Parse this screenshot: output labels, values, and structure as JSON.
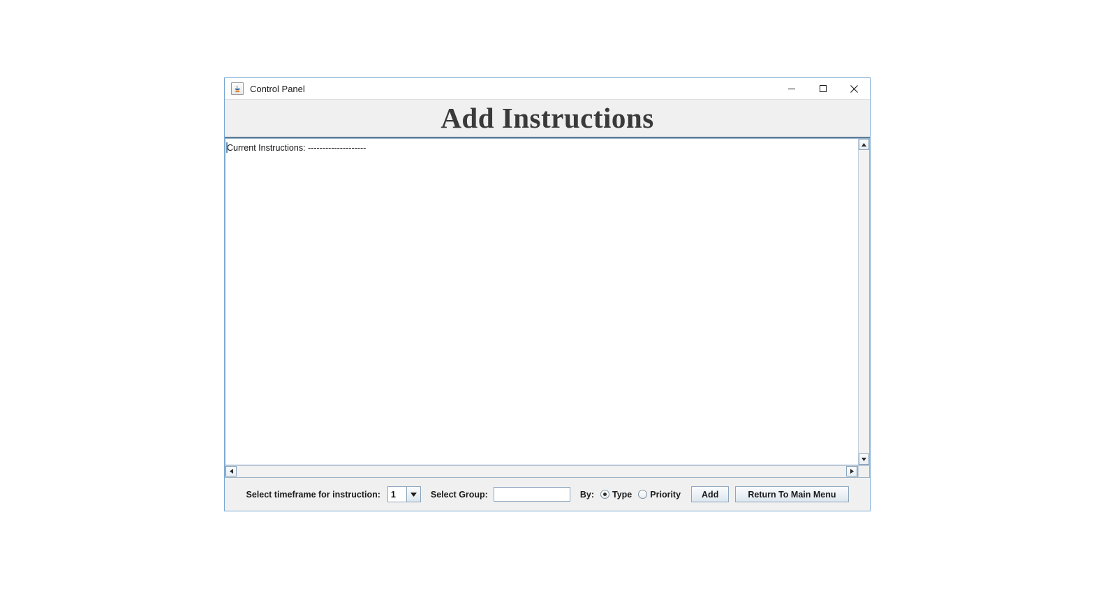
{
  "window": {
    "title": "Control Panel",
    "app_icon": "java-coffee-cup-icon",
    "controls": {
      "minimize": "minimize-icon",
      "maximize": "maximize-icon",
      "close": "close-icon"
    }
  },
  "header": {
    "title": "Add Instructions"
  },
  "text_area": {
    "content": "Current Instructions: --------------------",
    "placeholder": ""
  },
  "scrollbars": {
    "vertical": {
      "up_arrow": "triangle-up-icon",
      "down_arrow": "triangle-down-icon"
    },
    "horizontal": {
      "left_arrow": "triangle-left-icon",
      "right_arrow": "triangle-right-icon"
    }
  },
  "toolbar": {
    "timeframe_label": "Select timeframe for instruction:",
    "timeframe_value": "1",
    "timeframe_options": [
      "1"
    ],
    "group_label": "Select Group:",
    "group_value": "",
    "group_placeholder": "",
    "by_label": "By:",
    "radios": [
      {
        "label": "Type",
        "checked": true
      },
      {
        "label": "Priority",
        "checked": false
      }
    ],
    "add_button": "Add",
    "return_button": "Return To Main Menu"
  },
  "colors": {
    "window_border": "#7aa8d0",
    "panel_bg": "#f0f0f0",
    "header_rule": "#5b7c99",
    "text_primary": "#1b1b1b",
    "heading": "#3a3a3a",
    "field_border": "#8ca6bd",
    "textarea_bg": "#ffffff"
  }
}
